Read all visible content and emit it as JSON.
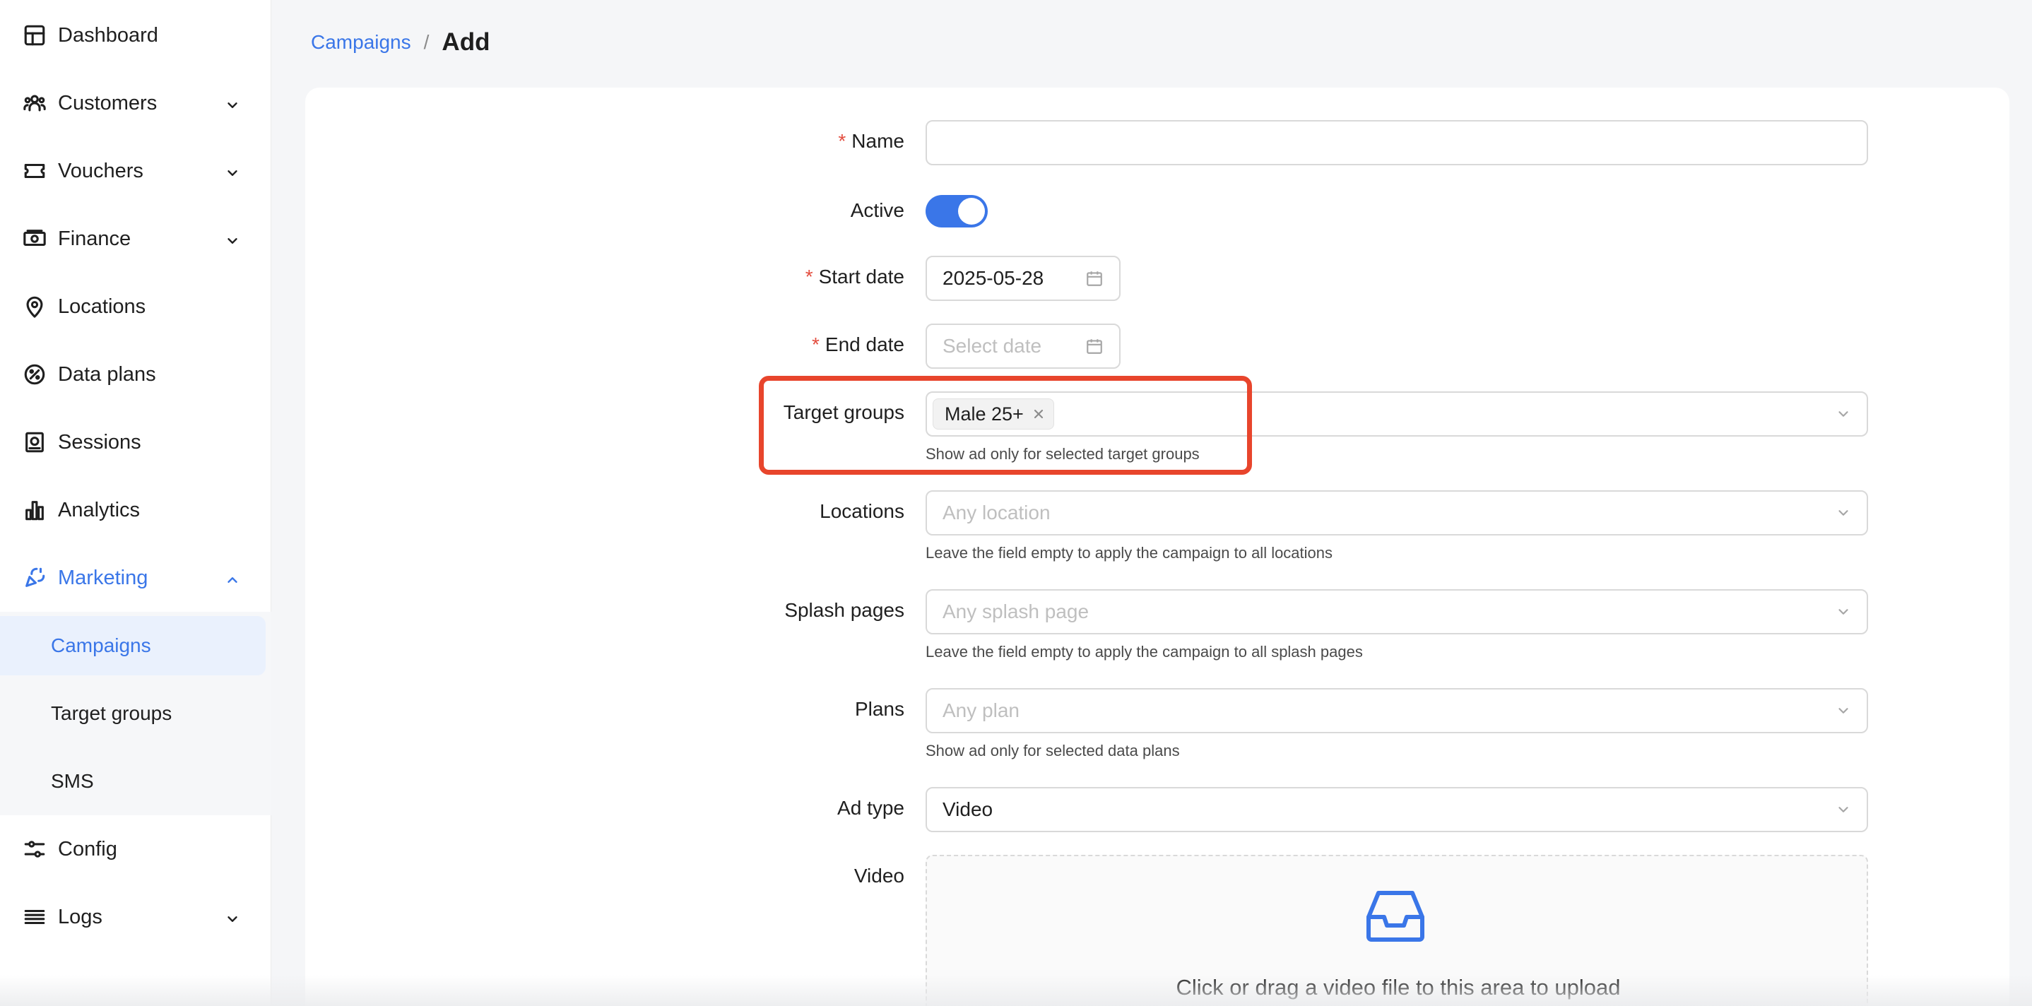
{
  "sidebar": {
    "items": [
      {
        "label": "Dashboard",
        "icon": "dashboard-icon"
      },
      {
        "label": "Customers",
        "icon": "customers-icon",
        "has_submenu": true
      },
      {
        "label": "Vouchers",
        "icon": "voucher-icon",
        "has_submenu": true
      },
      {
        "label": "Finance",
        "icon": "finance-icon",
        "has_submenu": true
      },
      {
        "label": "Locations",
        "icon": "location-pin-icon"
      },
      {
        "label": "Data plans",
        "icon": "data-plans-icon"
      },
      {
        "label": "Sessions",
        "icon": "sessions-icon"
      },
      {
        "label": "Analytics",
        "icon": "analytics-icon"
      },
      {
        "label": "Marketing",
        "icon": "marketing-icon",
        "has_submenu": true,
        "expanded": true
      },
      {
        "label": "Config",
        "icon": "config-icon"
      },
      {
        "label": "Logs",
        "icon": "logs-icon",
        "has_submenu": true
      }
    ],
    "marketing_submenu": [
      {
        "label": "Campaigns",
        "selected": true
      },
      {
        "label": "Target groups"
      },
      {
        "label": "SMS"
      }
    ]
  },
  "breadcrumb": {
    "parent": "Campaigns",
    "separator": "/",
    "current": "Add"
  },
  "form": {
    "name": {
      "label": "Name",
      "required": true,
      "value": ""
    },
    "active": {
      "label": "Active",
      "checked": true
    },
    "start_date": {
      "label": "Start date",
      "required": true,
      "value": "2025-05-28"
    },
    "end_date": {
      "label": "End date",
      "required": true,
      "placeholder": "Select date"
    },
    "target_groups": {
      "label": "Target groups",
      "tags": [
        "Male 25+"
      ],
      "help": "Show ad only for selected target groups"
    },
    "locations": {
      "label": "Locations",
      "placeholder": "Any location",
      "help": "Leave the field empty to apply the campaign to all locations"
    },
    "splash_pages": {
      "label": "Splash pages",
      "placeholder": "Any splash page",
      "help": "Leave the field empty to apply the campaign to all splash pages"
    },
    "plans": {
      "label": "Plans",
      "placeholder": "Any plan",
      "help": "Show ad only for selected data plans"
    },
    "ad_type": {
      "label": "Ad type",
      "value": "Video"
    },
    "video": {
      "label": "Video",
      "upload_text": "Click or drag a video file to this area to upload",
      "icon": "inbox-icon"
    }
  },
  "colors": {
    "accent": "#3a76e8",
    "highlight": "#e8452c",
    "required": "#e34d3f"
  }
}
